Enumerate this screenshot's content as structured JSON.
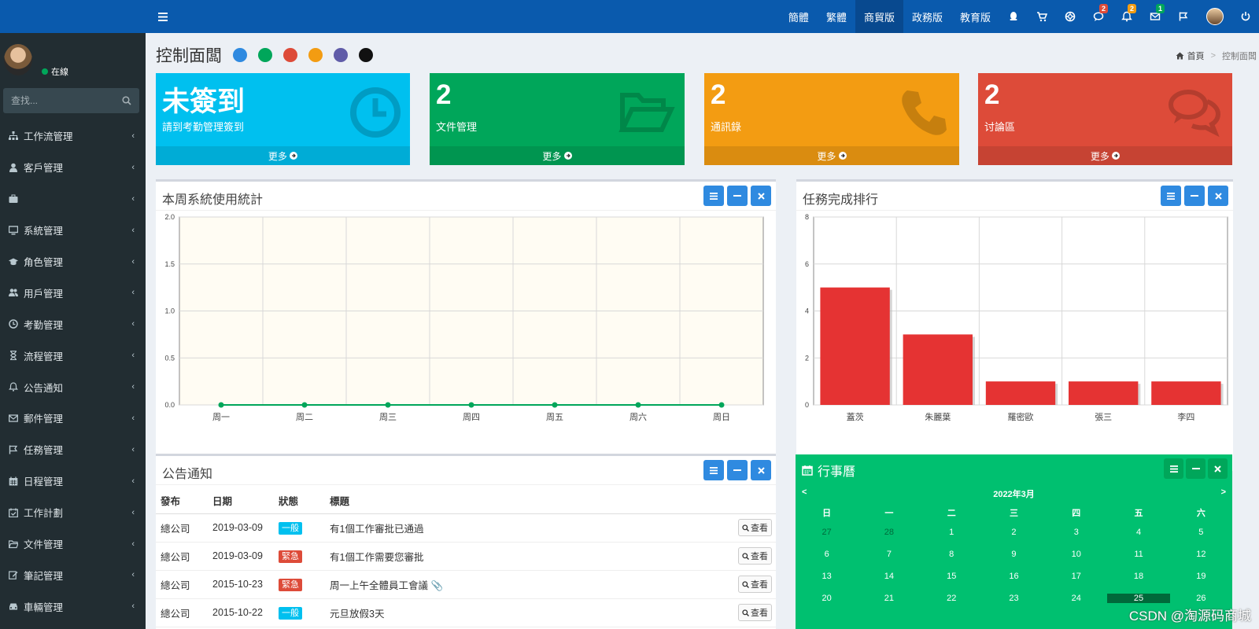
{
  "topnav": {
    "items": [
      "簡體",
      "繁體",
      "商貿版",
      "政務版",
      "教育版"
    ],
    "badges": {
      "messages": "2",
      "notifications": "2",
      "mail": "1"
    },
    "colors": {
      "messages": "#dd4b39",
      "notifications": "#f39c12",
      "mail": "#00a65a"
    }
  },
  "sidebar": {
    "status": "在線",
    "search_placeholder": "查找...",
    "items": [
      {
        "label": "工作流管理",
        "icon": "sitemap-icon"
      },
      {
        "label": "客戶管理",
        "icon": "user-icon"
      },
      {
        "label": "",
        "icon": "briefcase-icon"
      },
      {
        "label": "系統管理",
        "icon": "desktop-icon"
      },
      {
        "label": "角色管理",
        "icon": "graduation-cap-icon"
      },
      {
        "label": "用戶管理",
        "icon": "users-icon"
      },
      {
        "label": "考勤管理",
        "icon": "clock-icon"
      },
      {
        "label": "流程管理",
        "icon": "hourglass-icon"
      },
      {
        "label": "公告通知",
        "icon": "bell-icon"
      },
      {
        "label": "郵件管理",
        "icon": "envelope-icon"
      },
      {
        "label": "任務管理",
        "icon": "flag-icon"
      },
      {
        "label": "日程管理",
        "icon": "calendar-icon"
      },
      {
        "label": "工作計劃",
        "icon": "calendar-check-icon"
      },
      {
        "label": "文件管理",
        "icon": "folder-icon"
      },
      {
        "label": "筆記管理",
        "icon": "edit-icon"
      },
      {
        "label": "車輛管理",
        "icon": "car-icon"
      }
    ]
  },
  "page": {
    "title": "控制面闆",
    "theme_colors": [
      "#2f8ae0",
      "#00a65a",
      "#dd4b39",
      "#f39c12",
      "#605ca8",
      "#111111"
    ],
    "breadcrumb": {
      "home": "首頁",
      "current": "控制面闆"
    }
  },
  "stats": [
    {
      "value": "未簽到",
      "label": "請到考勤管理簽到",
      "more": "更多",
      "color": "#00c0ef",
      "icon": "clock-icon"
    },
    {
      "value": "2",
      "label": "文件管理",
      "more": "更多",
      "color": "#00a65a",
      "icon": "folder-open-icon"
    },
    {
      "value": "2",
      "label": "通訊錄",
      "more": "更多",
      "color": "#f39c12",
      "icon": "phone-icon"
    },
    {
      "value": "2",
      "label": "讨論區",
      "more": "更多",
      "color": "#dd4b39",
      "icon": "comments-icon"
    }
  ],
  "weekly": {
    "title": "本周系統使用統計"
  },
  "ranking": {
    "title": "任務完成排行"
  },
  "chart_data": [
    {
      "type": "line",
      "categories": [
        "周一",
        "周二",
        "周三",
        "周四",
        "周五",
        "周六",
        "周日"
      ],
      "values": [
        0,
        0,
        0,
        0,
        0,
        0,
        0
      ],
      "yticks": [
        "0.0",
        "0.5",
        "1.0",
        "1.5",
        "2.0"
      ],
      "ylim": [
        0,
        2
      ],
      "grid": true,
      "color": "#00a65a"
    },
    {
      "type": "bar",
      "categories": [
        "蓋茨",
        "朱麗葉",
        "羅密歐",
        "張三",
        "李四"
      ],
      "values": [
        5,
        3,
        1,
        1,
        1
      ],
      "yticks": [
        "0",
        "2",
        "4",
        "6",
        "8"
      ],
      "ylim": [
        0,
        8
      ],
      "grid": true,
      "color": "#e53333"
    }
  ],
  "announcements": {
    "title": "公告通知",
    "columns": [
      "發布",
      "日期",
      "狀態",
      "標題"
    ],
    "view_label": "查看",
    "rows": [
      {
        "publisher": "總公司",
        "date": "2019-03-09",
        "status": "一般",
        "status_color": "#00c0ef",
        "title": "有1個工作審批已通過",
        "attach": false
      },
      {
        "publisher": "總公司",
        "date": "2019-03-09",
        "status": "緊急",
        "status_color": "#dd4b39",
        "title": "有1個工作需要您審批",
        "attach": false
      },
      {
        "publisher": "總公司",
        "date": "2015-10-23",
        "status": "緊急",
        "status_color": "#dd4b39",
        "title": "周一上午全體員工會議",
        "attach": true
      },
      {
        "publisher": "總公司",
        "date": "2015-10-22",
        "status": "一般",
        "status_color": "#00c0ef",
        "title": "元旦放假3天",
        "attach": false
      }
    ]
  },
  "calendar": {
    "title": "行事曆",
    "month": "2022年3月",
    "prev": "<",
    "next": ">",
    "weekdays": [
      "日",
      "一",
      "二",
      "三",
      "四",
      "五",
      "六"
    ],
    "weeks": [
      [
        "27",
        "28",
        "1",
        "2",
        "3",
        "4",
        "5"
      ],
      [
        "6",
        "7",
        "8",
        "9",
        "10",
        "11",
        "12"
      ],
      [
        "13",
        "14",
        "15",
        "16",
        "17",
        "18",
        "19"
      ],
      [
        "20",
        "21",
        "22",
        "23",
        "24",
        "25",
        "26"
      ]
    ],
    "today": "25"
  },
  "watermark": "CSDN @淘源码商城"
}
